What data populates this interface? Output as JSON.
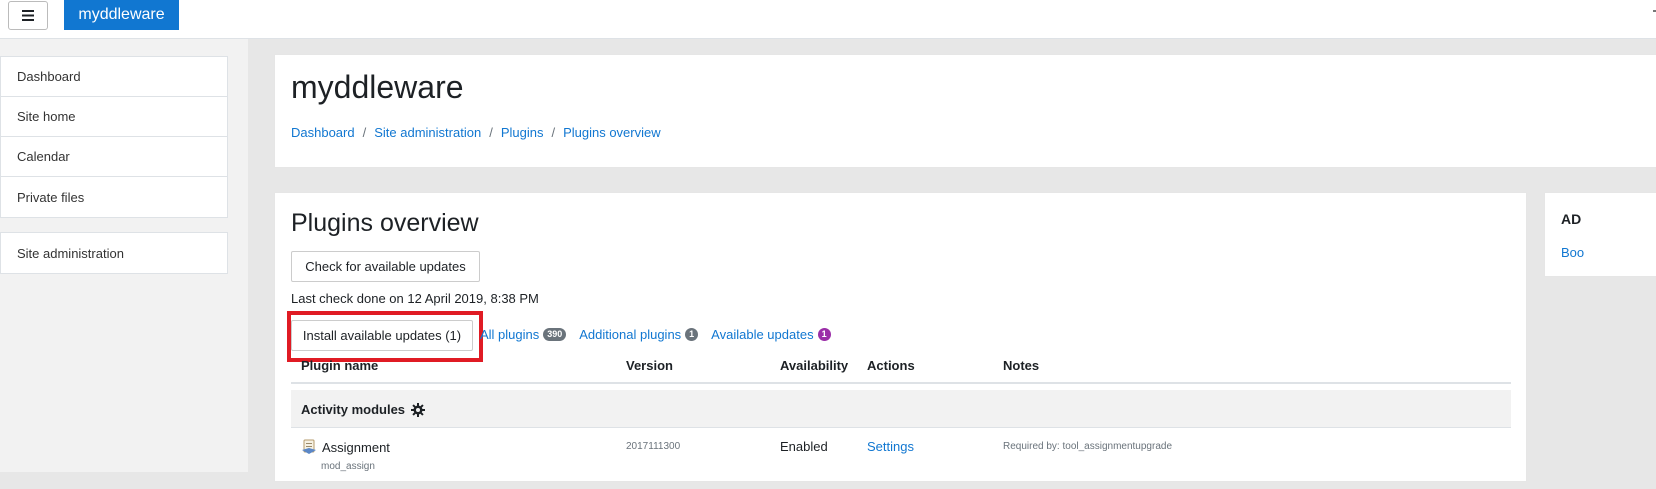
{
  "navbar": {
    "brand": "myddleware",
    "menu_icon": "hamburger-icon"
  },
  "drawer": {
    "items": [
      {
        "label": "Dashboard"
      },
      {
        "label": "Site home"
      },
      {
        "label": "Calendar"
      },
      {
        "label": "Private files"
      }
    ],
    "admin_item": {
      "label": "Site administration"
    }
  },
  "header": {
    "title": "myddleware",
    "breadcrumb": [
      "Dashboard",
      "Site administration",
      "Plugins",
      "Plugins overview"
    ]
  },
  "main": {
    "heading": "Plugins overview",
    "check_button": "Check for available updates",
    "last_check": "Last check done on 12 April 2019, 8:38 PM",
    "install_button": "Install available updates (1)",
    "filters": [
      {
        "label": "All plugins",
        "badge": "390",
        "badge_color": "#6a737b"
      },
      {
        "label": "Additional plugins",
        "badge": "1",
        "badge_color": "#6a737b"
      },
      {
        "label": "Available updates",
        "badge": "1",
        "badge_color": "#9b2ea8"
      }
    ],
    "table": {
      "headers": [
        "Plugin name",
        "Version",
        "Availability",
        "Actions",
        "Notes"
      ],
      "category": "Activity modules",
      "rows": [
        {
          "name": "Assignment",
          "component": "mod_assign",
          "version": "2017111300",
          "availability": "Enabled",
          "action": "Settings",
          "notes": "Required by: tool_assignmentupgrade"
        }
      ]
    }
  },
  "right_block": {
    "title": "AD",
    "link": "Boo"
  },
  "colors": {
    "brand": "#1177d1",
    "link": "#1177d1",
    "highlight": "#e01b24"
  }
}
